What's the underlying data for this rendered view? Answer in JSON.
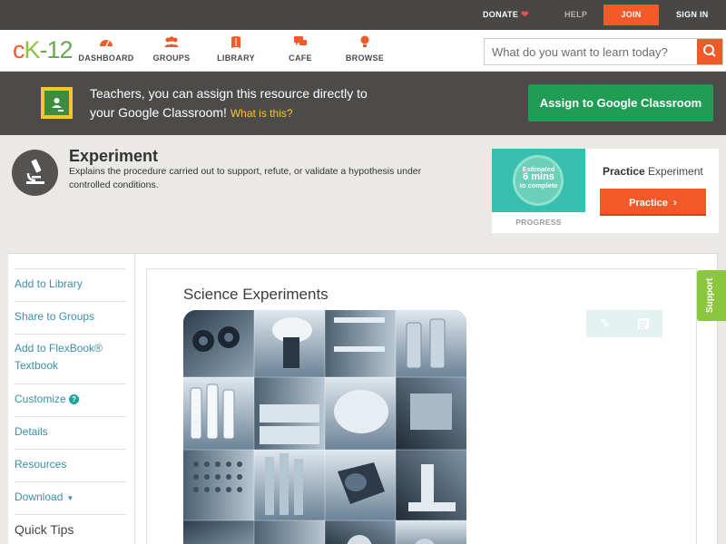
{
  "topbar": {
    "donate": "DONATE",
    "help": "HELP",
    "join": "JOIN",
    "sign_in": "SIGN IN"
  },
  "nav": {
    "logo": {
      "c": "c",
      "k": "K",
      "n": "-12"
    },
    "items": [
      {
        "label": "DASHBOARD",
        "icon": "dashboard-icon"
      },
      {
        "label": "GROUPS",
        "icon": "groups-icon"
      },
      {
        "label": "LIBRARY",
        "icon": "library-icon"
      },
      {
        "label": "CAFE",
        "icon": "cafe-icon"
      },
      {
        "label": "BROWSE",
        "icon": "browse-icon"
      }
    ],
    "search_placeholder": "What do you want to learn today?"
  },
  "banner": {
    "line1": "Teachers, you can assign this resource directly to",
    "line2": "your Google Classroom!",
    "what": "What is this?",
    "assign_button": "Assign to Google Classroom"
  },
  "concept": {
    "title": "Experiment",
    "description": "Explains the procedure carried out to support, refute, or validate a hypothesis under controlled conditions."
  },
  "practice": {
    "estimated": "Estimated",
    "minutes": "6 mins",
    "to_complete": "to complete",
    "progress_label": "PROGRESS",
    "title_bold": "Practice",
    "title_rest": "Experiment",
    "button": "Practice"
  },
  "sidebar": {
    "items": [
      {
        "label": "Add to Library"
      },
      {
        "label": "Share to Groups"
      },
      {
        "label": "Add to FlexBook®"
      },
      {
        "label": "Textbook"
      },
      {
        "label": "Customize"
      },
      {
        "label": "Details"
      },
      {
        "label": "Resources"
      },
      {
        "label": "Download"
      }
    ],
    "quick_tips": "Quick Tips"
  },
  "content": {
    "title": "Science Experiments"
  },
  "support": "Support",
  "colors": {
    "accent": "#f05a28",
    "green": "#1f9d55",
    "teal_link": "#3a8fa8",
    "support_green": "#8cc63f"
  }
}
